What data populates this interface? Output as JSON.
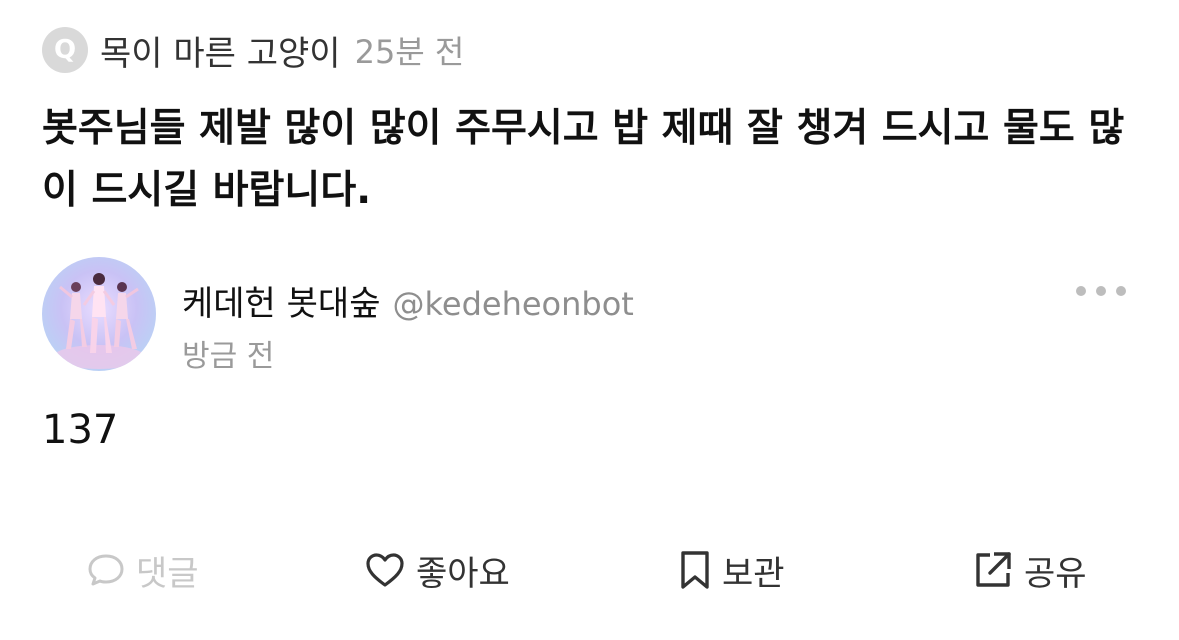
{
  "question": {
    "badge": "Q",
    "asker": "목이 마른 고양이",
    "time": "25분 전",
    "text": "봇주님들 제발 많이 많이 주무시고 밥 제때 잘 챙겨 드시고 물도 많이 드시길 바랍니다."
  },
  "answer": {
    "author_name": "케데헌 봇대숲",
    "author_handle": "@kedeheonbot",
    "time": "방금 전",
    "text": "137"
  },
  "actions": {
    "comment": "댓글",
    "like": "좋아요",
    "save": "보관",
    "share": "공유"
  },
  "colors": {
    "disabled": "#c8c8c8",
    "secondary_text": "#9a9a9a",
    "primary_text": "#111111"
  },
  "icons": {
    "comment": "speech-bubble-icon",
    "like": "heart-icon",
    "save": "bookmark-icon",
    "share": "share-icon",
    "more": "more-dots-icon"
  }
}
